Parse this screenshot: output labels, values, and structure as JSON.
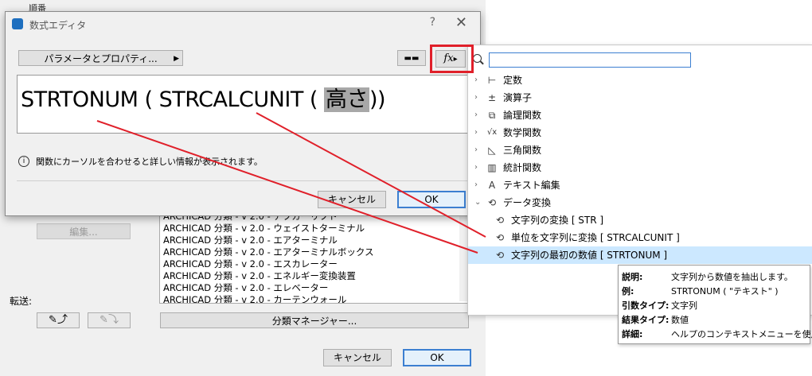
{
  "background_window": {
    "top_label": "順番",
    "edit_button": "編集...",
    "transfer_label": "転送:",
    "class_list": [
      "ARCHICAD 分類 - v 2.0 - アプガーリフト",
      "ARCHICAD 分類 - v 2.0 - ウェイストターミナル",
      "ARCHICAD 分類 - v 2.0 - エアターミナル",
      "ARCHICAD 分類 - v 2.0 - エアターミナルボックス",
      "ARCHICAD 分類 - v 2.0 - エスカレーター",
      "ARCHICAD 分類 - v 2.0 - エネルギー変換装置",
      "ARCHICAD 分類 - v 2.0 - エレベーター",
      "ARCHICAD 分類 - v 2.0 - カーテンウォール"
    ],
    "tool_icon_1": "✎⤴",
    "tool_icon_2": "✎⤵",
    "class_manager_button": "分類マネージャー...",
    "cancel_button": "キャンセル",
    "ok_button": "OK"
  },
  "formula_editor": {
    "title": "数式エディタ",
    "help_glyph": "?",
    "close_glyph": "✕",
    "param_button": "パラメータとプロパティ...",
    "param_arrow": "▶",
    "unit_icon": "▬▬",
    "fx_label": "fx",
    "fx_arrow": "▸",
    "formula_prefix": "STRTONUM ( STRCALCUNIT ( ",
    "formula_selected": "高さ",
    "formula_suffix": "))",
    "info_glyph": "i",
    "info_text": "関数にカーソルを合わせると詳しい情報が表示されます。",
    "cancel_button": "キャンセル",
    "ok_button": "OK"
  },
  "function_picker": {
    "search_value": "",
    "categories": [
      {
        "label": "定数",
        "icon": "⊢",
        "chevron": "›"
      },
      {
        "label": "演算子",
        "icon": "±",
        "chevron": "›"
      },
      {
        "label": "論理関数",
        "icon": "⧉",
        "chevron": "›"
      },
      {
        "label": "数学関数",
        "icon": "√x",
        "chevron": "›"
      },
      {
        "label": "三角関数",
        "icon": "◺",
        "chevron": "›"
      },
      {
        "label": "統計関数",
        "icon": "▥",
        "chevron": "›"
      },
      {
        "label": "テキスト編集",
        "icon": "A",
        "chevron": "›"
      },
      {
        "label": "データ変換",
        "icon": "⟲",
        "chevron": "⌄"
      }
    ],
    "children": [
      {
        "label": "文字列の変換 [ STR ]",
        "icon": "⟲"
      },
      {
        "label": "単位を文字列に変換 [ STRCALCUNIT ]",
        "icon": "⟲"
      },
      {
        "label": "文字列の最初の数値 [ STRTONUM ]",
        "icon": "⟲"
      }
    ]
  },
  "tooltip": {
    "rows": [
      {
        "key": "説明:",
        "value": "文字列から数値を抽出します。"
      },
      {
        "key": "例:",
        "value": "STRTONUM ( \"テキスト\" )"
      },
      {
        "key": "引数タイプ:",
        "value": "文字列"
      },
      {
        "key": "結果タイプ:",
        "value": "数値"
      },
      {
        "key": "詳細:",
        "value": "ヘルプのコンテキストメニューを使用"
      }
    ]
  },
  "colors": {
    "annotation_red": "#e0202a",
    "selection_blue": "#cce8ff",
    "primary_border": "#3c7fd1"
  }
}
